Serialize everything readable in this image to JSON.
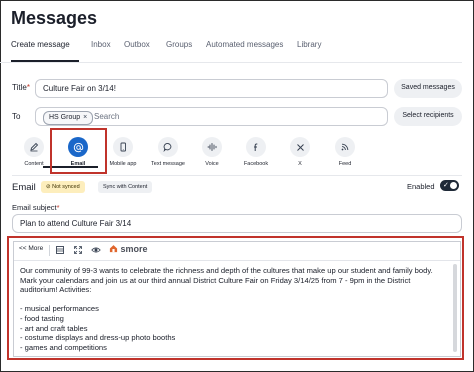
{
  "page": {
    "title": "Messages"
  },
  "tabs": [
    {
      "label": "Create message"
    },
    {
      "label": "Inbox"
    },
    {
      "label": "Outbox"
    },
    {
      "label": "Groups"
    },
    {
      "label": "Automated messages"
    },
    {
      "label": "Library"
    }
  ],
  "form": {
    "title_label": "Title",
    "required_mark": "*",
    "title_value": "Culture Fair on 3/14!",
    "saved_messages_label": "Saved messages",
    "to_label": "To",
    "to_tag": "HS Group",
    "to_tag_remove": "×",
    "to_placeholder": "Search",
    "select_recipients_label": "Select recipients"
  },
  "channels": [
    {
      "label": "Content",
      "icon": "edit-icon"
    },
    {
      "label": "Email",
      "icon": "at-icon",
      "active": true
    },
    {
      "label": "Mobile app",
      "icon": "phone-icon"
    },
    {
      "label": "Text message",
      "icon": "chat-icon"
    },
    {
      "label": "Voice",
      "icon": "waveform-icon"
    },
    {
      "label": "Facebook",
      "icon": "facebook-icon"
    },
    {
      "label": "X",
      "icon": "x-icon"
    },
    {
      "label": "Feed",
      "icon": "rss-icon"
    }
  ],
  "email": {
    "heading": "Email",
    "not_synced": "Not synced",
    "sync_with_content": "Sync with Content",
    "enabled_label": "Enabled",
    "subject_label": "Email subject",
    "subject_value": "Plan to attend Culture Fair 3/14"
  },
  "editor": {
    "more_label": "<< More",
    "brand": "smore",
    "paragraph1": "Our community of 99-3 wants to celebrate the richness and depth of the cultures that make up our student and family body. Mark your calendars and join us at our third annual District Culture Fair on Friday 3/14/25 from 7 - 9pm in the District auditorium! Activities:",
    "items": [
      "- musical performances",
      "- food tasting",
      "- art and craft tables",
      "- costume displays and dress-up photo booths",
      "- games and competitions"
    ]
  },
  "colors": {
    "accent": "#1a67c9",
    "highlight": "#c0332b",
    "badge_yellow": "#fdeebd"
  }
}
